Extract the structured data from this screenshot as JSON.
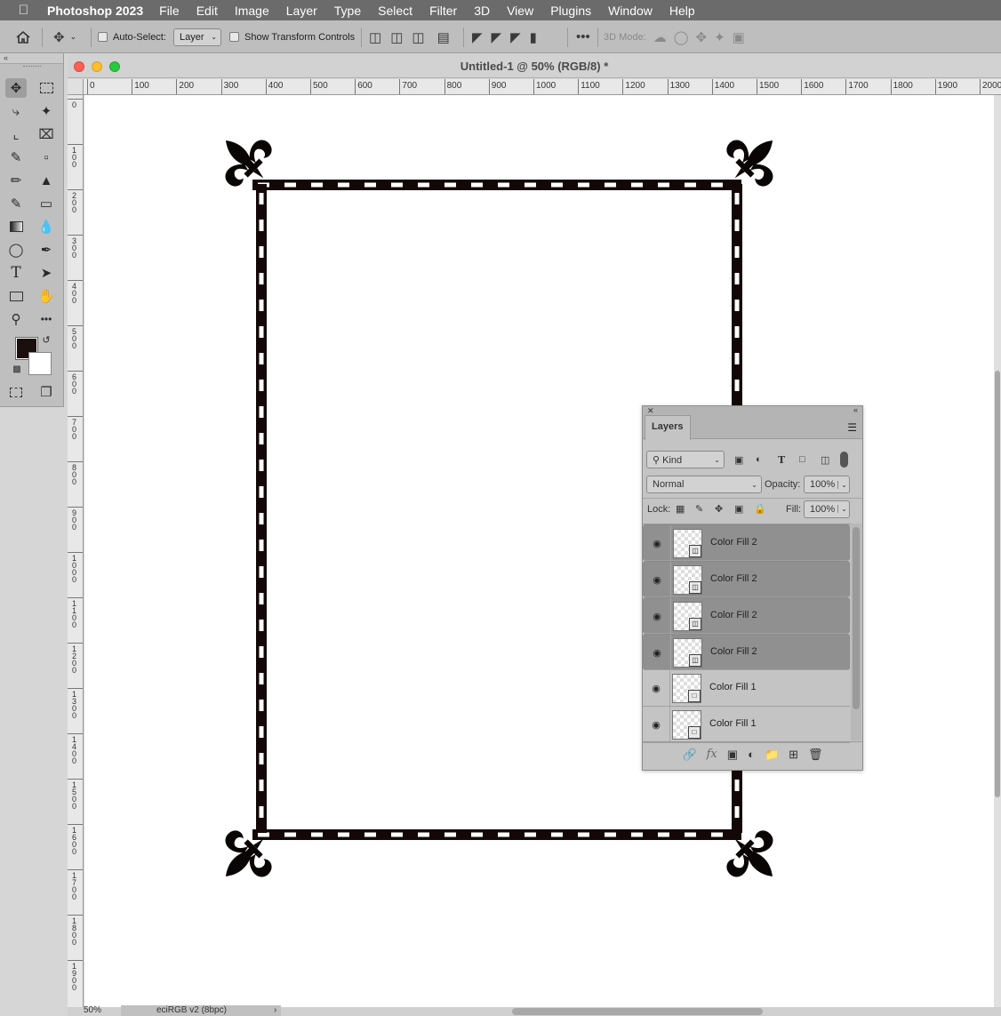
{
  "menubar": {
    "app_name": "Photoshop 2023",
    "items": [
      "File",
      "Edit",
      "Image",
      "Layer",
      "Type",
      "Select",
      "Filter",
      "3D",
      "View",
      "Plugins",
      "Window",
      "Help"
    ]
  },
  "options": {
    "auto_select_label": "Auto-Select:",
    "auto_select_value": "Layer",
    "transform_label": "Show Transform Controls",
    "mode_3d_label": "3D Mode:"
  },
  "document": {
    "title": "Untitled-1 @ 50% (RGB/8) *",
    "zoom": "50%",
    "color_profile": "eciRGB v2 (8bpc)",
    "h_ruler": [
      "0",
      "100",
      "200",
      "300",
      "400",
      "500",
      "600",
      "700",
      "800",
      "900",
      "1000",
      "1100",
      "1200",
      "1300",
      "1400",
      "1500",
      "1600",
      "1700",
      "1800",
      "1900",
      "2000"
    ],
    "v_ruler": [
      "0",
      "100",
      "200",
      "300",
      "400",
      "500",
      "600",
      "700",
      "800",
      "900",
      "1000",
      "1100",
      "1200",
      "1300",
      "1400",
      "1500",
      "1600",
      "1700",
      "1800",
      "1900"
    ]
  },
  "layers_panel": {
    "tab_label": "Layers",
    "filter_kind": "Kind",
    "blend_mode": "Normal",
    "opacity_label": "Opacity:",
    "opacity_value": "100%",
    "lock_label": "Lock:",
    "fill_label": "Fill:",
    "fill_value": "100%",
    "layers": [
      {
        "name": "Color Fill 2",
        "selected": true
      },
      {
        "name": "Color Fill 2",
        "selected": true
      },
      {
        "name": "Color Fill 2",
        "selected": true
      },
      {
        "name": "Color Fill 2",
        "selected": true
      },
      {
        "name": "Color Fill 1",
        "selected": false
      },
      {
        "name": "Color Fill 1",
        "selected": false
      }
    ]
  },
  "colors": {
    "foreground": "#1a0f0c",
    "background": "#ffffff",
    "frame": "#140707"
  }
}
